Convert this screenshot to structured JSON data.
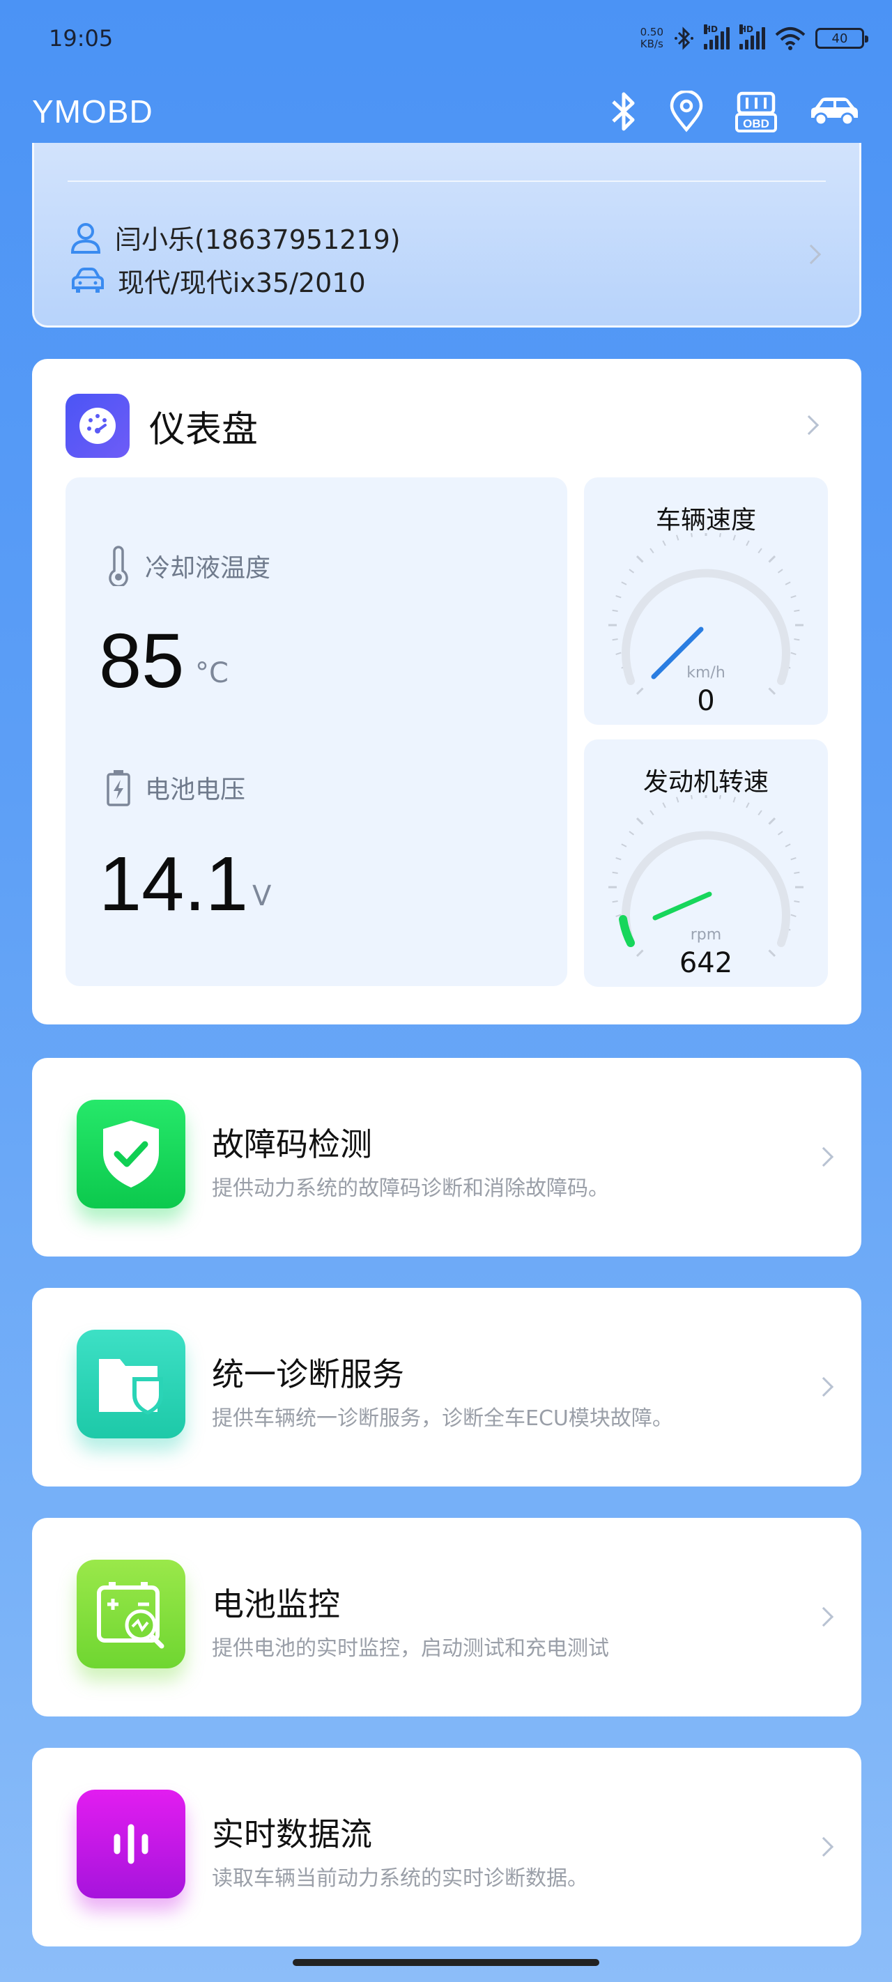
{
  "status_bar": {
    "time": "19:05",
    "net_speed_value": "0.50",
    "net_speed_unit": "KB/s",
    "signal1_label": "HD",
    "signal2_label": "HD",
    "battery": "40"
  },
  "app_bar": {
    "title": "YMOBD",
    "icons": [
      "bluetooth-icon",
      "location-icon",
      "obd-icon",
      "car-icon"
    ],
    "obd_label": "OBD"
  },
  "user": {
    "name": "闫小乐(18637951219)",
    "vehicle": "现代/现代ix35/2010"
  },
  "dashboard": {
    "title": "仪表盘",
    "coolant_label": "冷却液温度",
    "coolant_value": "85",
    "coolant_unit": "°C",
    "battery_label": "电池电压",
    "battery_value": "14.1",
    "battery_unit": "V",
    "speed": {
      "title": "车辆速度",
      "unit": "km/h",
      "value": "0"
    },
    "rpm": {
      "title": "发动机转速",
      "unit": "rpm",
      "value": "642"
    }
  },
  "features": [
    {
      "title": "故障码检测",
      "desc": "提供动力系统的故障码诊断和消除故障码。",
      "icon": "shield-check-icon"
    },
    {
      "title": "统一诊断服务",
      "desc": "提供车辆统一诊断服务，诊断全车ECU模块故障。",
      "icon": "folder-shield-icon"
    },
    {
      "title": "电池监控",
      "desc": "提供电池的实时监控，启动测试和充电测试",
      "icon": "battery-monitor-icon"
    },
    {
      "title": "实时数据流",
      "desc": "读取车辆当前动力系统的实时诊断数据。",
      "icon": "data-stream-icon"
    }
  ],
  "colors": {
    "accent": "#4b93f5",
    "gauge_speed_needle": "#2a7de1",
    "gauge_rpm_needle": "#17d65b"
  }
}
